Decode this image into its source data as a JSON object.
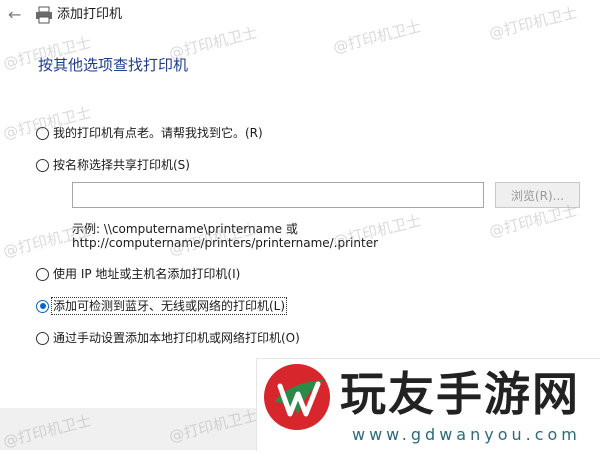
{
  "window": {
    "title": "添加打印机",
    "back_icon": "back-arrow-icon",
    "printer_icon": "printer-icon"
  },
  "heading": "按其他选项查找打印机",
  "options": [
    {
      "label": "我的打印机有点老。请帮我找到它。(R)",
      "checked": false
    },
    {
      "label": "按名称选择共享打印机(S)",
      "checked": false
    },
    {
      "label": "使用 IP 地址或主机名添加打印机(I)",
      "checked": false
    },
    {
      "label": "添加可检测到蓝牙、无线或网络的打印机(L)",
      "checked": true
    },
    {
      "label": "通过手动设置添加本地打印机或网络打印机(O)",
      "checked": false
    }
  ],
  "shared_printer": {
    "input_value": "",
    "browse_label": "浏览(R)...",
    "example_line1": "示例: \\\\computername\\printername 或",
    "example_line2": "http://computername/printers/printername/.printer"
  },
  "watermark_text": "@打印机卫士",
  "logo": {
    "name": "玩友手游网",
    "url": "www.gdwanyou.com",
    "colors": {
      "red": "#d7262c",
      "green": "#2b8a4a"
    }
  }
}
